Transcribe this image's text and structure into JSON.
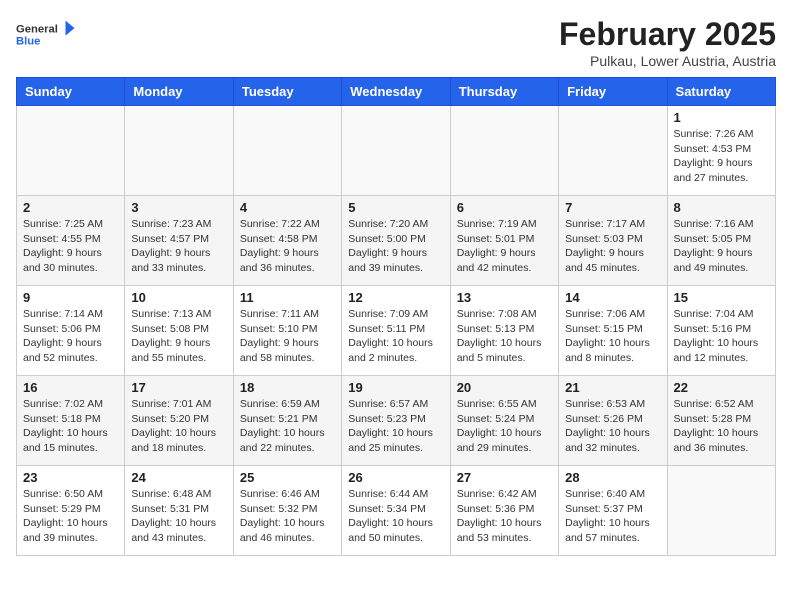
{
  "logo": {
    "general": "General",
    "blue": "Blue"
  },
  "title": "February 2025",
  "subtitle": "Pulkau, Lower Austria, Austria",
  "days_of_week": [
    "Sunday",
    "Monday",
    "Tuesday",
    "Wednesday",
    "Thursday",
    "Friday",
    "Saturday"
  ],
  "weeks": [
    [
      {
        "day": "",
        "info": ""
      },
      {
        "day": "",
        "info": ""
      },
      {
        "day": "",
        "info": ""
      },
      {
        "day": "",
        "info": ""
      },
      {
        "day": "",
        "info": ""
      },
      {
        "day": "",
        "info": ""
      },
      {
        "day": "1",
        "info": "Sunrise: 7:26 AM\nSunset: 4:53 PM\nDaylight: 9 hours and 27 minutes."
      }
    ],
    [
      {
        "day": "2",
        "info": "Sunrise: 7:25 AM\nSunset: 4:55 PM\nDaylight: 9 hours and 30 minutes."
      },
      {
        "day": "3",
        "info": "Sunrise: 7:23 AM\nSunset: 4:57 PM\nDaylight: 9 hours and 33 minutes."
      },
      {
        "day": "4",
        "info": "Sunrise: 7:22 AM\nSunset: 4:58 PM\nDaylight: 9 hours and 36 minutes."
      },
      {
        "day": "5",
        "info": "Sunrise: 7:20 AM\nSunset: 5:00 PM\nDaylight: 9 hours and 39 minutes."
      },
      {
        "day": "6",
        "info": "Sunrise: 7:19 AM\nSunset: 5:01 PM\nDaylight: 9 hours and 42 minutes."
      },
      {
        "day": "7",
        "info": "Sunrise: 7:17 AM\nSunset: 5:03 PM\nDaylight: 9 hours and 45 minutes."
      },
      {
        "day": "8",
        "info": "Sunrise: 7:16 AM\nSunset: 5:05 PM\nDaylight: 9 hours and 49 minutes."
      }
    ],
    [
      {
        "day": "9",
        "info": "Sunrise: 7:14 AM\nSunset: 5:06 PM\nDaylight: 9 hours and 52 minutes."
      },
      {
        "day": "10",
        "info": "Sunrise: 7:13 AM\nSunset: 5:08 PM\nDaylight: 9 hours and 55 minutes."
      },
      {
        "day": "11",
        "info": "Sunrise: 7:11 AM\nSunset: 5:10 PM\nDaylight: 9 hours and 58 minutes."
      },
      {
        "day": "12",
        "info": "Sunrise: 7:09 AM\nSunset: 5:11 PM\nDaylight: 10 hours and 2 minutes."
      },
      {
        "day": "13",
        "info": "Sunrise: 7:08 AM\nSunset: 5:13 PM\nDaylight: 10 hours and 5 minutes."
      },
      {
        "day": "14",
        "info": "Sunrise: 7:06 AM\nSunset: 5:15 PM\nDaylight: 10 hours and 8 minutes."
      },
      {
        "day": "15",
        "info": "Sunrise: 7:04 AM\nSunset: 5:16 PM\nDaylight: 10 hours and 12 minutes."
      }
    ],
    [
      {
        "day": "16",
        "info": "Sunrise: 7:02 AM\nSunset: 5:18 PM\nDaylight: 10 hours and 15 minutes."
      },
      {
        "day": "17",
        "info": "Sunrise: 7:01 AM\nSunset: 5:20 PM\nDaylight: 10 hours and 18 minutes."
      },
      {
        "day": "18",
        "info": "Sunrise: 6:59 AM\nSunset: 5:21 PM\nDaylight: 10 hours and 22 minutes."
      },
      {
        "day": "19",
        "info": "Sunrise: 6:57 AM\nSunset: 5:23 PM\nDaylight: 10 hours and 25 minutes."
      },
      {
        "day": "20",
        "info": "Sunrise: 6:55 AM\nSunset: 5:24 PM\nDaylight: 10 hours and 29 minutes."
      },
      {
        "day": "21",
        "info": "Sunrise: 6:53 AM\nSunset: 5:26 PM\nDaylight: 10 hours and 32 minutes."
      },
      {
        "day": "22",
        "info": "Sunrise: 6:52 AM\nSunset: 5:28 PM\nDaylight: 10 hours and 36 minutes."
      }
    ],
    [
      {
        "day": "23",
        "info": "Sunrise: 6:50 AM\nSunset: 5:29 PM\nDaylight: 10 hours and 39 minutes."
      },
      {
        "day": "24",
        "info": "Sunrise: 6:48 AM\nSunset: 5:31 PM\nDaylight: 10 hours and 43 minutes."
      },
      {
        "day": "25",
        "info": "Sunrise: 6:46 AM\nSunset: 5:32 PM\nDaylight: 10 hours and 46 minutes."
      },
      {
        "day": "26",
        "info": "Sunrise: 6:44 AM\nSunset: 5:34 PM\nDaylight: 10 hours and 50 minutes."
      },
      {
        "day": "27",
        "info": "Sunrise: 6:42 AM\nSunset: 5:36 PM\nDaylight: 10 hours and 53 minutes."
      },
      {
        "day": "28",
        "info": "Sunrise: 6:40 AM\nSunset: 5:37 PM\nDaylight: 10 hours and 57 minutes."
      },
      {
        "day": "",
        "info": ""
      }
    ]
  ]
}
